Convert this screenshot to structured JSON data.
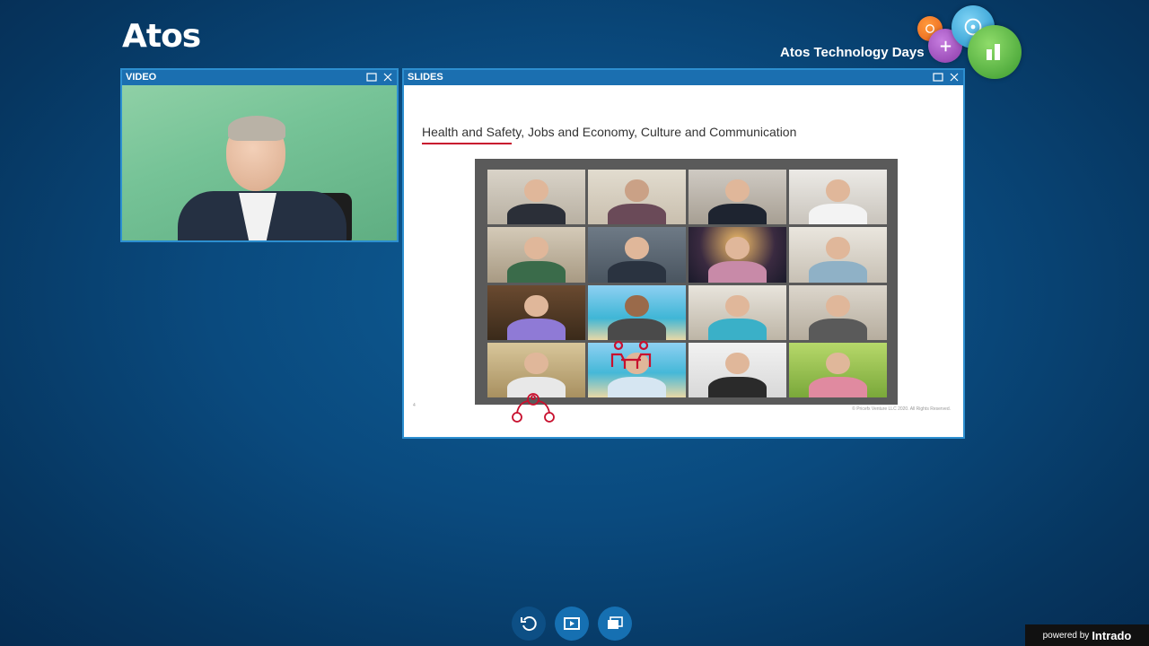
{
  "brand": {
    "logo_text": "Atos",
    "event_title": "Atos Technology Days"
  },
  "video_panel": {
    "title": "VIDEO"
  },
  "slides_panel": {
    "title": "SLIDES",
    "slide_title": "Health and Safety, Jobs and Economy, Culture and Communication",
    "slide_number": "4",
    "footer": "© Pricefx Venture LLC 2020. All Rights Reserved."
  },
  "toolbar": {
    "items": [
      "refresh-icon",
      "presentation-icon",
      "slides-icon"
    ]
  },
  "powered_by": {
    "prefix": "powered by",
    "brand": "Intrado"
  },
  "colors": {
    "accent": "#1b6fb0",
    "slide_red": "#c8102e"
  }
}
